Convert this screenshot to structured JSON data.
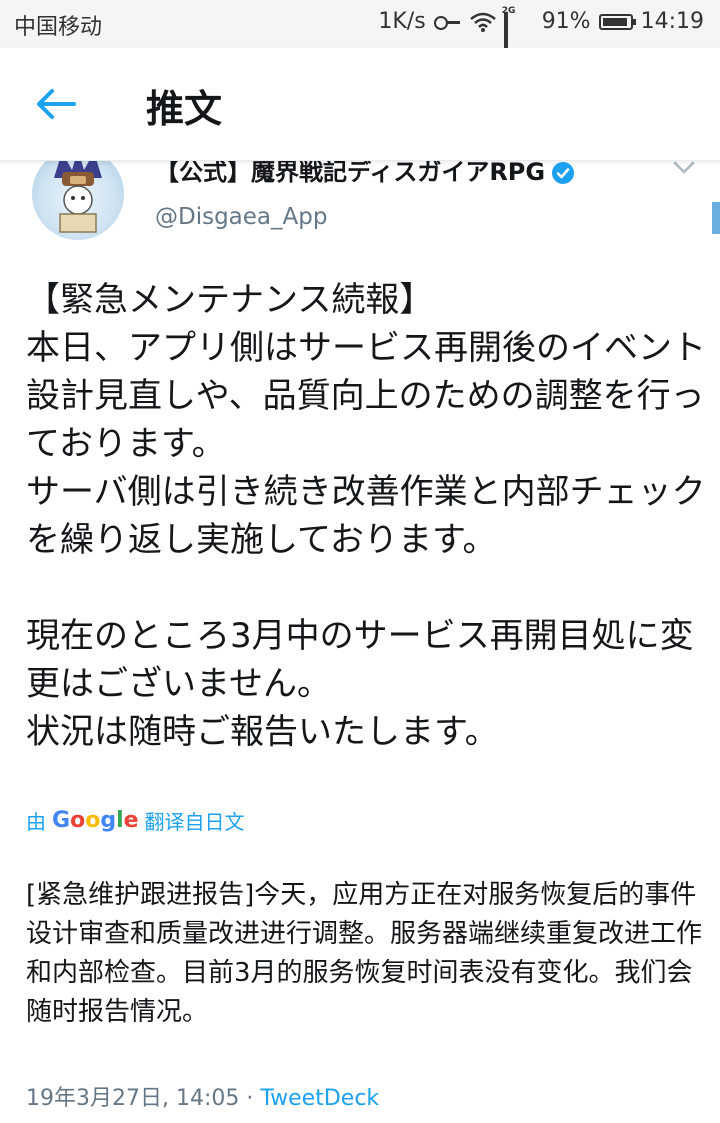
{
  "status_bar": {
    "carrier": "中国移动",
    "speed": "1K/s",
    "network": "2G",
    "battery": "91%",
    "time": "14:19"
  },
  "header": {
    "title": "推文"
  },
  "tweet": {
    "display_name": "【公式】魔界戦記ディスガイアRPG",
    "handle": "@Disgaea_App",
    "text": "【緊急メンテナンス続報】\n本日、アプリ側はサービス再開後のイベント設計見直しや、品質向上のための調整を行っております。\nサーバ側は引き続き改善作業と内部チェックを繰り返し実施しております。\n\n現在のところ3月中のサービス再開目処に変更はございません。\n状況は随時ご報告いたします。",
    "translate_prefix": "由",
    "translate_brand": "Google",
    "translate_suffix": "翻译自日文",
    "translated_text": "[紧急维护跟进报告]今天，应用方正在对服务恢复后的事件设计审查和质量改进进行调整。服务器端继续重复改进工作和内部检查。目前3月的服务恢复时间表没有变化。我们会随时报告情况。",
    "timestamp": "19年3月27日, 14:05",
    "separator": " · ",
    "client": "TweetDeck"
  },
  "colors": {
    "accent": "#1da1f2",
    "muted": "#657786",
    "text": "#14171a"
  },
  "icons": [
    "key-icon",
    "wifi-icon",
    "signal-icon",
    "battery-icon",
    "back-arrow-icon",
    "verified-icon",
    "chevron-down-icon"
  ]
}
